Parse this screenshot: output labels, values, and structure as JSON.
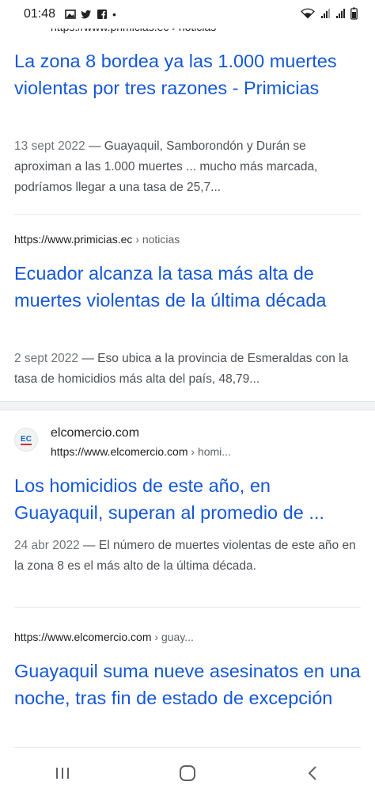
{
  "status_bar": {
    "time": "01:48",
    "dot": "•",
    "icons_left": [
      "gallery-icon",
      "twitter-icon",
      "facebook-icon"
    ],
    "icons_right": [
      "wifi-icon",
      "signal-icon",
      "signal-icon",
      "battery-icon"
    ]
  },
  "results": {
    "r1": {
      "url_partial": "https://www.primicias.ec › noticias",
      "title": "La zona 8 bordea ya las 1.000 muertes violentas por tres razones - Primicias",
      "date": "13 sept 2022",
      "snippet": " — Guayaquil, Samborondón y Durán se aproximan a las 1.000 muertes ... mucho más marcada, podríamos llegar a una tasa de 25,7..."
    },
    "r2": {
      "url": "https://www.primicias.ec",
      "crumb": " › noticias",
      "title": "Ecuador alcanza la tasa más alta de muertes violentas de la última década",
      "date": "2 sept 2022",
      "snippet": " — Eso ubica a la provincia de Esmeraldas con la tasa de homicidios más alta del país, 48,79..."
    },
    "r3": {
      "favicon_text": "EC",
      "site": "elcomercio.com",
      "url": "https://www.elcomercio.com",
      "crumb": " › homi...",
      "title": "Los homicidios de este año, en Guayaquil, superan al promedio de ...",
      "date": "24 abr 2022",
      "snippet": " — El número de muertes violentas de este año en la zona 8 es el más alto de la última década."
    },
    "r4": {
      "url": "https://www.elcomercio.com",
      "crumb": " › guay...",
      "title": "Guayaquil suma nueve asesinatos en una noche, tras fin de estado de excepción"
    }
  },
  "nav_bar": {
    "buttons": [
      "recent-apps-icon",
      "home-icon",
      "back-icon"
    ]
  }
}
